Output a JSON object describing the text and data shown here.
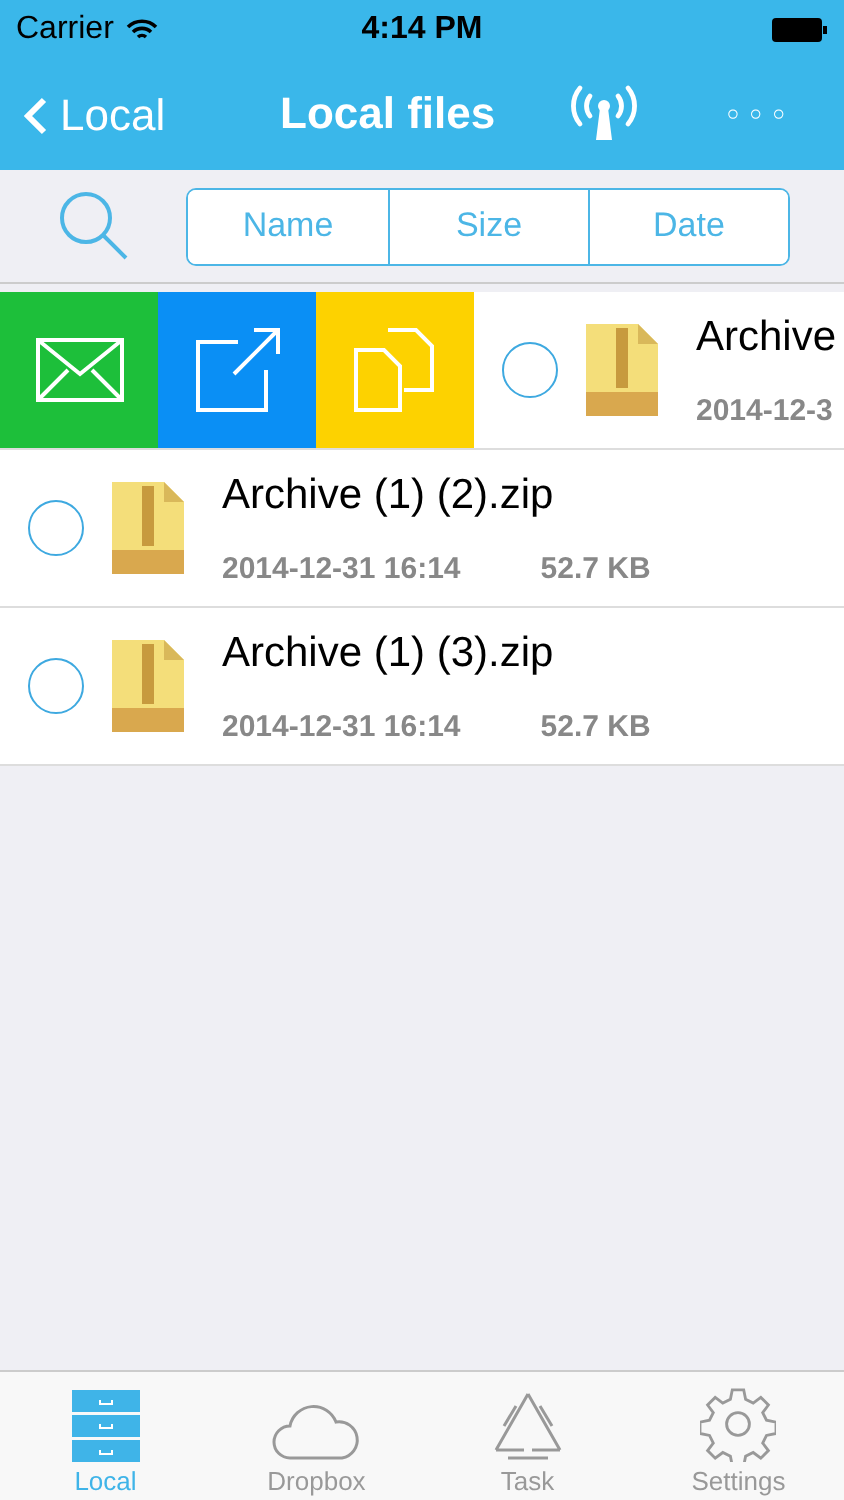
{
  "status_bar": {
    "carrier": "Carrier",
    "time": "4:14 PM"
  },
  "nav_bar": {
    "back": "Local",
    "title": "Local files",
    "more": "◦◦◦"
  },
  "sort_buttons": [
    "Name",
    "Size",
    "Date"
  ],
  "files": [
    {
      "kind": "swiped",
      "name": "Archive",
      "date": "2014-12-3",
      "checked": false
    },
    {
      "kind": "normal",
      "name": "Archive (1) (2).zip",
      "date": "2014-12-31 16:14",
      "size": "52.7 KB",
      "checked": false
    },
    {
      "kind": "normal",
      "name": "Archive (1) (3).zip",
      "date": "2014-12-31 16:14",
      "size": "52.7 KB",
      "checked": false
    }
  ],
  "tab_bar": [
    {
      "label": "Local",
      "selected": true
    },
    {
      "label": "Dropbox",
      "selected": false
    },
    {
      "label": "Task",
      "selected": false
    },
    {
      "label": "Settings",
      "selected": false
    }
  ]
}
